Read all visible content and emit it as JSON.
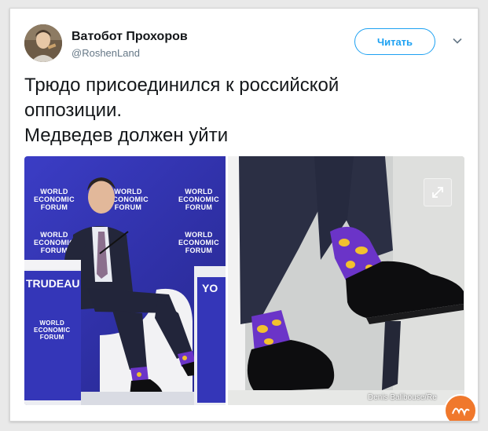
{
  "user": {
    "name": "Ватобот Прохоров",
    "handle": "@RoshenLand"
  },
  "follow_label": "Читать",
  "tweet_lines": [
    "Трюдо присоединился к российской",
    "оппозиции.",
    "Медведев должен уйти"
  ],
  "media": {
    "left_photo": {
      "wef_logo": [
        "WORLD",
        "ECONOMIC",
        "FORUM"
      ],
      "podium_text": "TRUDEAU",
      "podium_right_text": "YO"
    },
    "credit": "Denis Balibouse/Re",
    "watermark": "Nyka"
  },
  "icons": {
    "menu": "chevron-down-icon",
    "expand": "expand-arrows-icon"
  },
  "colors": {
    "accent": "#1da1f2",
    "wef_blue": "#3b3dc5",
    "sock_purple": "#6b34c8",
    "sock_yellow": "#f2c12e"
  }
}
